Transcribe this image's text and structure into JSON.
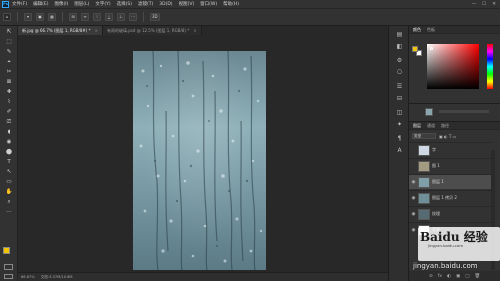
{
  "menubar": {
    "logo": "Ps",
    "items": [
      "文件(F)",
      "编辑(E)",
      "图像(I)",
      "图层(L)",
      "文字(Y)",
      "选择(S)",
      "滤镜(T)",
      "3D(D)",
      "视图(V)",
      "窗口(W)",
      "帮助(H)"
    ],
    "window_controls": [
      "—",
      "☐",
      "✕"
    ]
  },
  "options_bar": {
    "home_icon": "home-icon",
    "buttons": [
      "▾",
      "▣",
      "▦",
      "⊞",
      "≡",
      "⫶",
      "⟂",
      "⊥",
      "⋯",
      "3D"
    ]
  },
  "tabs": [
    {
      "label": "新.jpg @ 66.7% (图层 1, RGB/8#) *",
      "close": "×",
      "active": true
    },
    {
      "label": "有雨的玻璃.psd @ 12.5% (图层 1, RGB/8) *",
      "close": "×",
      "active": false
    }
  ],
  "status": {
    "zoom": "66.67%",
    "doc": "文档:3.37M/10.6M"
  },
  "color_panel": {
    "tabs": [
      "颜色",
      "色板"
    ],
    "fg_color": "#f3c500",
    "bg_color": "#ffffff"
  },
  "layers_panel": {
    "tabs": [
      "图层",
      "通道",
      "路径"
    ],
    "filter_label": "类型",
    "rows": [
      {
        "name": "字",
        "visible": false,
        "selected": false
      },
      {
        "name": "图 1",
        "visible": false,
        "selected": false
      },
      {
        "name": "图层 1",
        "visible": true,
        "selected": true
      },
      {
        "name": "图层 1 拷贝 2",
        "visible": true,
        "selected": false
      },
      {
        "name": "纹理",
        "visible": true,
        "selected": false
      },
      {
        "name": "背景",
        "visible": true,
        "selected": false
      }
    ],
    "bottom_icons": [
      "⊘",
      "fx",
      "◐",
      "▣",
      "□",
      "🗑"
    ]
  },
  "watermark": {
    "brand": "Baidu 经验",
    "sub": "jingyan.baidu.com",
    "url": "jingyan.baidu.com"
  },
  "tools": [
    "⇱",
    "⬚",
    "✎",
    "⌖",
    "✂",
    "⊠",
    "✚",
    "⌇",
    "✐",
    "⎚",
    "◖",
    "◉",
    "⬤",
    "T",
    "↖",
    "▭",
    "✋",
    "⌕",
    "⋯"
  ],
  "dock_icons": [
    "▤",
    "◧",
    "⚙",
    "⎔",
    "☰",
    "⊟",
    "◫",
    "✦",
    "¶",
    "A"
  ]
}
